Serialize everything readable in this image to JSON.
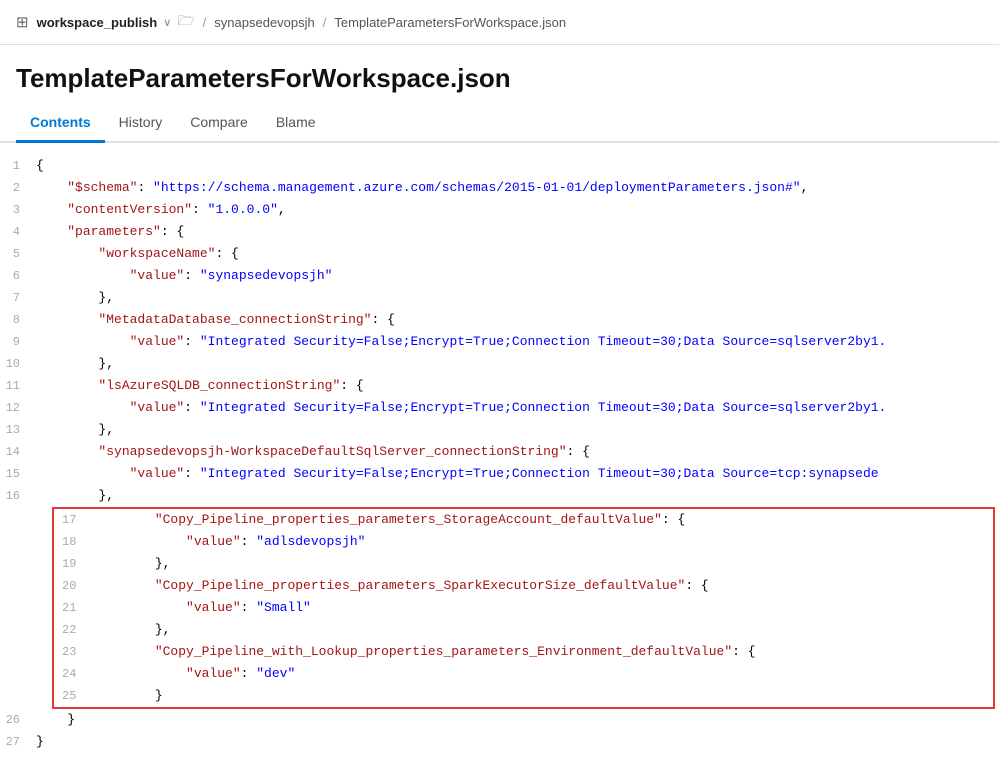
{
  "topbar": {
    "repo_icon": "⊞",
    "repo_name": "workspace_publish",
    "chevron": "∨",
    "folder_icon": "📁",
    "separator1": "/",
    "breadcrumb1": "synapsedevopsjh",
    "separator2": "/",
    "breadcrumb2": "TemplateParametersForWorkspace.json"
  },
  "page": {
    "title": "TemplateParametersForWorkspace.json"
  },
  "tabs": [
    {
      "label": "Contents",
      "active": true
    },
    {
      "label": "History",
      "active": false
    },
    {
      "label": "Compare",
      "active": false
    },
    {
      "label": "Blame",
      "active": false
    }
  ],
  "lines": [
    {
      "num": 1,
      "content": "{"
    },
    {
      "num": 2,
      "content": "    \"$schema\": \"https://schema.management.azure.com/schemas/2015-01-01/deploymentParameters.json#\","
    },
    {
      "num": 3,
      "content": "    \"contentVersion\": \"1.0.0.0\","
    },
    {
      "num": 4,
      "content": "    \"parameters\": {"
    },
    {
      "num": 5,
      "content": "        \"workspaceName\": {"
    },
    {
      "num": 6,
      "content": "            \"value\": \"synapsedevopsjh\""
    },
    {
      "num": 7,
      "content": "        },"
    },
    {
      "num": 8,
      "content": "        \"MetadataDatabase_connectionString\": {"
    },
    {
      "num": 9,
      "content": "            \"value\": \"Integrated Security=False;Encrypt=True;Connection Timeout=30;Data Source=sqlserver2by1."
    },
    {
      "num": 10,
      "content": "        },"
    },
    {
      "num": 11,
      "content": "        \"lsAzureSQLDB_connectionString\": {"
    },
    {
      "num": 12,
      "content": "            \"value\": \"Integrated Security=False;Encrypt=True;Connection Timeout=30;Data Source=sqlserver2by1."
    },
    {
      "num": 13,
      "content": "        },"
    },
    {
      "num": 14,
      "content": "        \"synapsedevopsjh-WorkspaceDefaultSqlServer_connectionString\": {"
    },
    {
      "num": 15,
      "content": "            \"value\": \"Integrated Security=False;Encrypt=True;Connection Timeout=30;Data Source=tcp:synapsede"
    },
    {
      "num": 16,
      "content": "        },"
    }
  ],
  "highlighted_lines": [
    {
      "num": 17,
      "content": "        \"Copy_Pipeline_properties_parameters_StorageAccount_defaultValue\": {"
    },
    {
      "num": 18,
      "content": "            \"value\": \"adlsdevopsjh\""
    },
    {
      "num": 19,
      "content": "        },"
    },
    {
      "num": 20,
      "content": "        \"Copy_Pipeline_properties_parameters_SparkExecutorSize_defaultValue\": {"
    },
    {
      "num": 21,
      "content": "            \"value\": \"Small\""
    },
    {
      "num": 22,
      "content": "        },"
    },
    {
      "num": 23,
      "content": "        \"Copy_Pipeline_with_Lookup_properties_parameters_Environment_defaultValue\": {"
    },
    {
      "num": 24,
      "content": "            \"value\": \"dev\""
    },
    {
      "num": 25,
      "content": "        }"
    }
  ],
  "closing_lines": [
    {
      "num": 26,
      "content": "    }"
    },
    {
      "num": 27,
      "content": "}"
    }
  ]
}
